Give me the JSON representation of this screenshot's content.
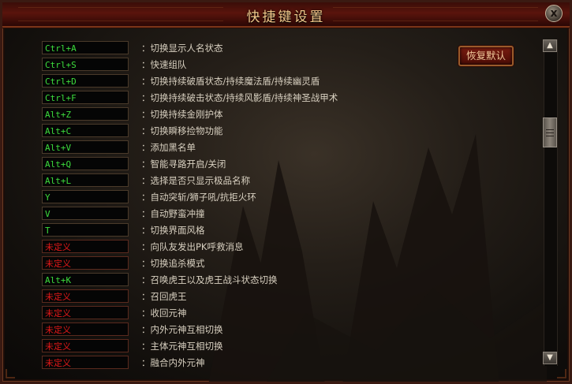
{
  "window": {
    "title": "快捷键设置",
    "close_label": "x"
  },
  "restore_button": "恢复默认",
  "bindings": [
    {
      "key": "Ctrl+A",
      "desc": "：切换显示人名状态",
      "defined": true
    },
    {
      "key": "Ctrl+S",
      "desc": "：快速组队",
      "defined": true
    },
    {
      "key": "Ctrl+D",
      "desc": "：切换持续破盾状态/持续魔法盾/持续幽灵盾",
      "defined": true
    },
    {
      "key": "Ctrl+F",
      "desc": "：切换持续破击状态/持续风影盾/持续神圣战甲术",
      "defined": true
    },
    {
      "key": "Alt+Z",
      "desc": "：切换持续金刚护体",
      "defined": true
    },
    {
      "key": "Alt+C",
      "desc": "：切换瞬移捡物功能",
      "defined": true
    },
    {
      "key": "Alt+V",
      "desc": "：添加黑名单",
      "defined": true
    },
    {
      "key": "Alt+Q",
      "desc": "：智能寻路开启/关闭",
      "defined": true
    },
    {
      "key": "Alt+L",
      "desc": "：选择是否只显示极品名称",
      "defined": true
    },
    {
      "key": "Y",
      "desc": "：自动突斩/狮子吼/抗拒火环",
      "defined": true
    },
    {
      "key": "V",
      "desc": "：自动野蛮冲撞",
      "defined": true
    },
    {
      "key": "T",
      "desc": "：切换界面风格",
      "defined": true
    },
    {
      "key": "未定义",
      "desc": "：向队友发出PK呼救消息",
      "defined": false
    },
    {
      "key": "未定义",
      "desc": "：切换追杀模式",
      "defined": false
    },
    {
      "key": "Alt+K",
      "desc": "：召唤虎王以及虎王战斗状态切换",
      "defined": true
    },
    {
      "key": "未定义",
      "desc": "：召回虎王",
      "defined": false
    },
    {
      "key": "未定义",
      "desc": "：收回元神",
      "defined": false
    },
    {
      "key": "未定义",
      "desc": "：内外元神互相切换",
      "defined": false
    },
    {
      "key": "未定义",
      "desc": "：主体元神互相切换",
      "defined": false
    },
    {
      "key": "未定义",
      "desc": "：融合内外元神",
      "defined": false
    }
  ],
  "scrollbar": {
    "up_icon": "triangle-up",
    "down_icon": "triangle-down"
  }
}
